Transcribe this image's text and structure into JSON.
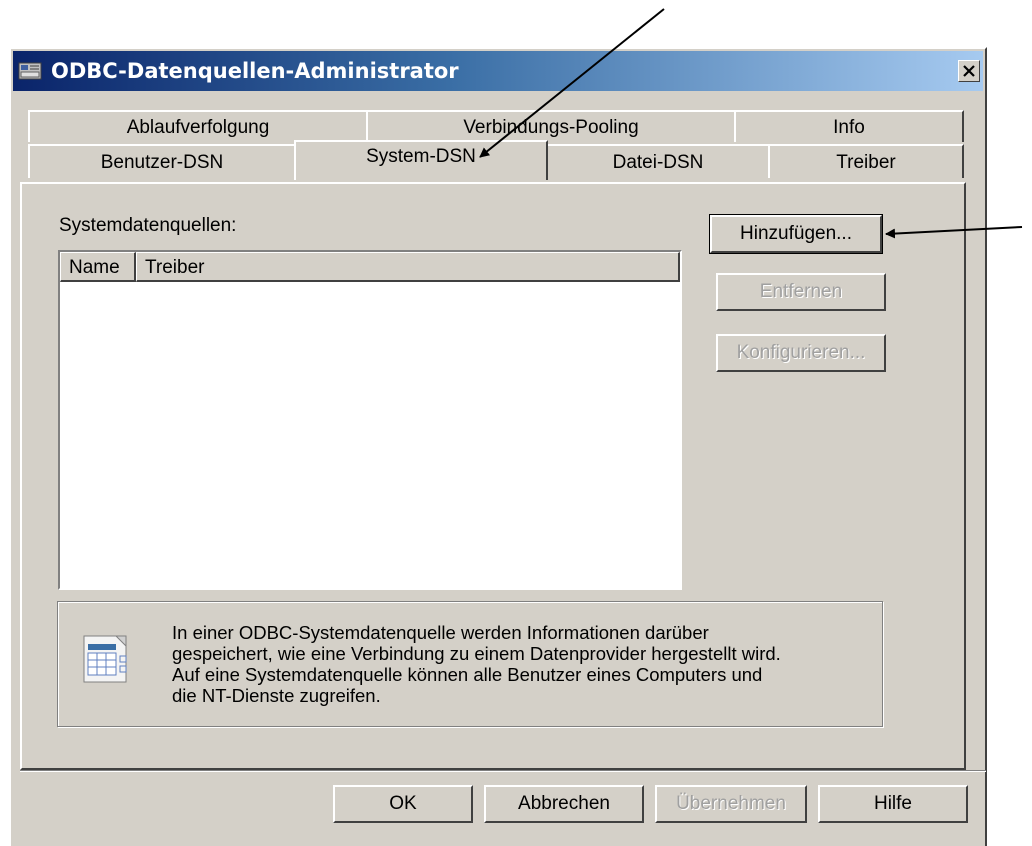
{
  "window": {
    "title": "ODBC-Datenquellen-Administrator"
  },
  "tabs": {
    "back_row": [
      "Ablaufverfolgung",
      "Verbindungs-Pooling",
      "Info"
    ],
    "front_row": [
      "Benutzer-DSN",
      "System-DSN",
      "Datei-DSN",
      "Treiber"
    ],
    "active": "System-DSN"
  },
  "panel": {
    "list_label": "Systemdatenquellen:",
    "columns": [
      "Name",
      "Treiber"
    ],
    "buttons": {
      "add": "Hinzufügen...",
      "remove": "Entfernen",
      "configure": "Konfigurieren..."
    },
    "info_lines": [
      "In einer ODBC-Systemdatenquelle werden Informationen darüber",
      "gespeichert, wie eine Verbindung zu einem Datenprovider hergestellt wird.",
      "Auf eine Systemdatenquelle können alle Benutzer eines Computers und",
      "die NT-Dienste zugreifen."
    ]
  },
  "footer": {
    "ok": "OK",
    "cancel": "Abbrechen",
    "apply": "Übernehmen",
    "help": "Hilfe"
  },
  "icons": {
    "title": "odbc-admin-icon",
    "info": "data-source-icon",
    "close": "close-icon"
  },
  "colors": {
    "title_start": "#0a246a",
    "title_end": "#a6caf0",
    "face": "#d4d0c8"
  }
}
